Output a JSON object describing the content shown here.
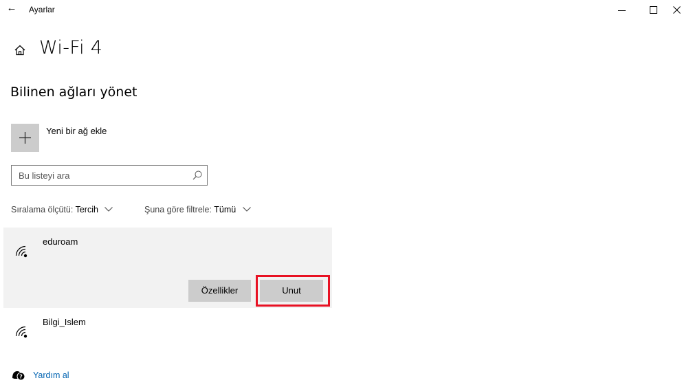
{
  "window": {
    "title": "Ayarlar"
  },
  "page": {
    "title": "Wi-Fi 4",
    "section_title": "Bilinen ağları yönet"
  },
  "add_network": {
    "label": "Yeni bir ağ ekle"
  },
  "search": {
    "placeholder": "Bu listeyi ara",
    "value": ""
  },
  "sort": {
    "label": "Sıralama ölçütü:",
    "value": "Tercih"
  },
  "filter": {
    "label": "Şuna göre filtrele:",
    "value": "Tümü"
  },
  "networks": [
    {
      "name": "eduroam",
      "selected": true
    },
    {
      "name": "Bilgi_Islem",
      "selected": false
    }
  ],
  "buttons": {
    "properties": "Özellikler",
    "forget": "Unut"
  },
  "help": {
    "label": "Yardım al"
  },
  "colors": {
    "accent": "#0063b1",
    "highlight": "#e81123",
    "selected_bg": "#f2f2f2",
    "button_bg": "#cccccc"
  }
}
